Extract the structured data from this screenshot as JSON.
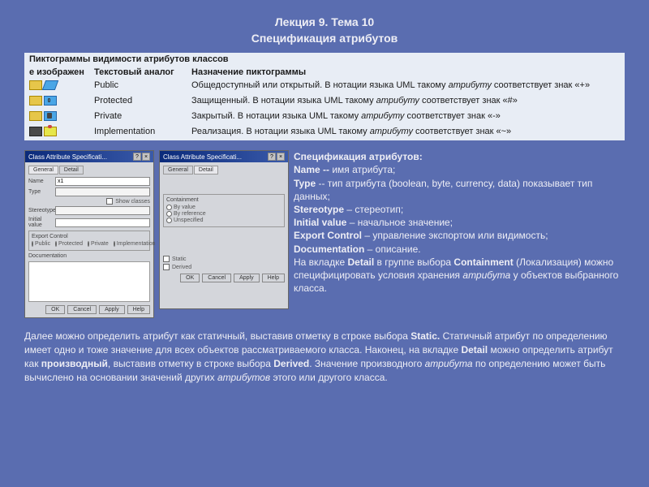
{
  "header": {
    "line1": "Лекция 9. Тема 10",
    "line2": "Спецификация атрибутов"
  },
  "table": {
    "title": "Пиктограммы видимости атрибутов классов",
    "head_icon": "е изображен",
    "head_text": "Текстовый аналог",
    "head_purpose": "Назначение пиктограммы",
    "rows": [
      {
        "text": "Public",
        "desc_a": "Общедоступный или открытый. В нотации языка UML такому ",
        "desc_i": "атрибуту",
        "desc_b": " соответствует знак «+»"
      },
      {
        "text": "Protected",
        "desc_a": "Защищенный. В нотации языка UML такому ",
        "desc_i": "атрибуту",
        "desc_b": " соответствует знак «#»"
      },
      {
        "text": "Private",
        "desc_a": "Закрытый. В нотации языка UML такому ",
        "desc_i": "атрибуту",
        "desc_b": " соответствует знак «-»"
      },
      {
        "text": "Implementation",
        "desc_a": "Реализация. В нотации языка UML такому ",
        "desc_i": "атрибуту",
        "desc_b": " соответствует знак «~»"
      }
    ]
  },
  "dialog1": {
    "title": "Class Attribute Specificati...",
    "tab1": "General",
    "tab2": "Detail",
    "name_lbl": "Name",
    "name_val": "x1",
    "type_lbl": "Type",
    "stereo_lbl": "Stereotype",
    "init_lbl": "Initial value",
    "show_cls": "Show classes",
    "export_title": "Export Control",
    "r_public": "Public",
    "r_protected": "Protected",
    "r_private": "Private",
    "r_impl": "Implementation",
    "doc_lbl": "Documentation",
    "ok": "OK",
    "cancel": "Cancel",
    "apply": "Apply",
    "help": "Help"
  },
  "dialog2": {
    "title": "Class Attribute Specificati...",
    "tab1": "General",
    "tab2": "Detail",
    "contain_title": "Containment",
    "r_byval": "By value",
    "r_byref": "By reference",
    "r_unspec": "Unspecified",
    "chk_static": "Static",
    "chk_derived": "Derived",
    "ok": "OK",
    "cancel": "Cancel",
    "apply": "Apply",
    "help": "Help"
  },
  "spec": {
    "l0": "Спецификация атрибутов:",
    "l1a": "Name -- ",
    "l1b": "имя атрибута;",
    "l2a": "Type",
    "l2b": " -- тип атрибута (boolean, byte, currency, data) показывает тип данных;",
    "l3a": "Stereotype",
    "l3b": " – стереотип;",
    "l4a": "Initial value",
    "l4b": " – начальное значение;",
    "l5a": "Export Control",
    "l5b": " – управление экспортом или видимость;",
    "l6a": "Documentation",
    "l6b": " – описание.",
    "l7a": "На вкладке ",
    "l7b": "Detail",
    "l7c": " в группе выбора ",
    "l7d": "Containment",
    "l7e": " (Локализация) можно специфицировать условия хранения ",
    "l7f": "атрибута",
    "l7g": " у объектов выбранного класса."
  },
  "bottom": {
    "p1a": "Далее можно определить атрибут как статичный, выставив отметку в строке выбора ",
    "p1b": "Static.",
    "p1c": " Статичный атрибут по определению имеет одно и тоже значение для всех объектов рассматриваемого класса. Наконец, на вкладке ",
    "p1d": "Detail",
    "p1e": " можно определить атрибут как ",
    "p1f": "производный",
    "p1g": ", выставив отметку в строке выбора ",
    "p1h": "Derived",
    "p1i": ". Значение производного ",
    "p1j": "атрибута",
    "p1k": " по определению может быть вычислено на основании значений других ",
    "p1l": "атрибутов",
    "p1m": " этого или другого класса."
  }
}
